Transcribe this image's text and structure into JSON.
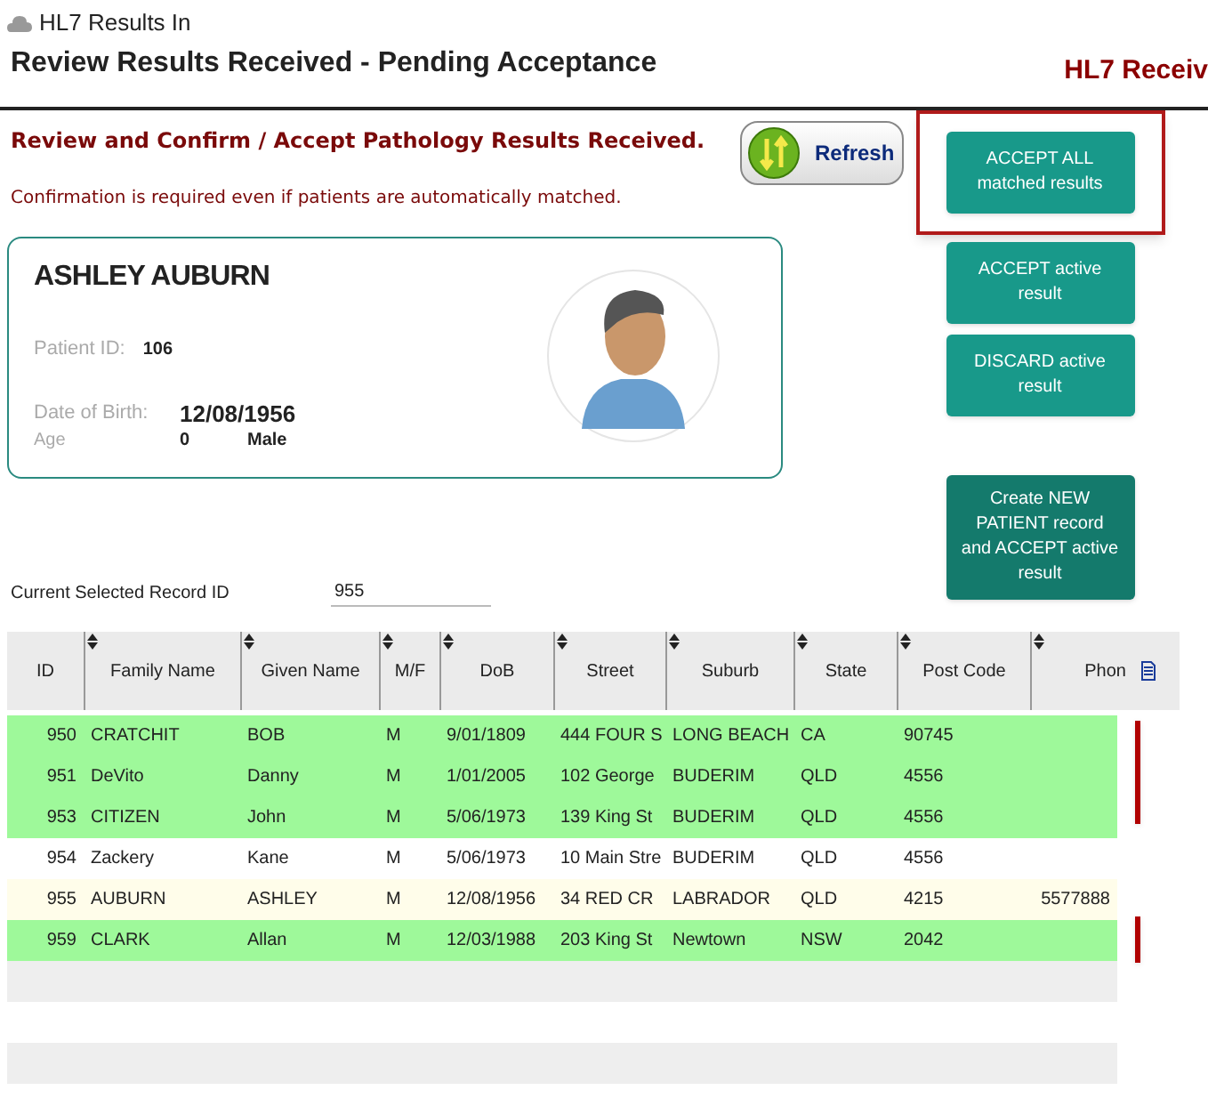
{
  "window": {
    "title": "HL7 Results In"
  },
  "header": {
    "title": "Review Results Received - Pending Acceptance",
    "right_title": "HL7 Receiv"
  },
  "intro": {
    "heading": "Review and Confirm / Accept Pathology Results Received.",
    "note": "Confirmation is required even if patients are automatically matched."
  },
  "refresh_button": "Refresh",
  "actions": [
    {
      "label": "ACCEPT ALL matched results",
      "kind": "standard",
      "highlighted": true
    },
    {
      "label": "ACCEPT active result",
      "kind": "standard",
      "highlighted": false
    },
    {
      "label": "DISCARD active result",
      "kind": "standard",
      "highlighted": false
    },
    {
      "label": "Create NEW PATIENT record and ACCEPT active result",
      "kind": "create",
      "highlighted": false
    }
  ],
  "patient": {
    "name": "ASHLEY AUBURN",
    "id_label": "Patient ID:",
    "id": "106",
    "dob_label": "Date of Birth:",
    "dob": "12/08/1956",
    "age_label": "Age",
    "age": "0",
    "sex": "Male"
  },
  "record": {
    "label": "Current Selected Record ID",
    "value": "955"
  },
  "table": {
    "columns": [
      "ID",
      "Family Name",
      "Given Name",
      "M/F",
      "DoB",
      "Street",
      "Suburb",
      "State",
      "Post Code",
      "Phon"
    ],
    "rows": [
      {
        "cells": [
          "950",
          "CRATCHIT",
          "BOB",
          "M",
          "9/01/1809",
          "444 FOUR S",
          "LONG BEACH",
          "CA",
          "90745",
          ""
        ],
        "matched": true,
        "selected": false
      },
      {
        "cells": [
          "951",
          "DeVito",
          "Danny",
          "M",
          "1/01/2005",
          "102 George",
          "BUDERIM",
          "QLD",
          "4556",
          ""
        ],
        "matched": true,
        "selected": false
      },
      {
        "cells": [
          "953",
          "CITIZEN",
          "John",
          "M",
          "5/06/1973",
          "139 King St",
          "BUDERIM",
          "QLD",
          "4556",
          ""
        ],
        "matched": true,
        "selected": false
      },
      {
        "cells": [
          "954",
          "Zackery",
          "Kane",
          "M",
          "5/06/1973",
          "10 Main Stre",
          "BUDERIM",
          "QLD",
          "4556",
          ""
        ],
        "matched": false,
        "selected": false
      },
      {
        "cells": [
          "955",
          "AUBURN",
          "ASHLEY",
          "M",
          "12/08/1956",
          "34 RED CR",
          "LABRADOR",
          "QLD",
          "4215",
          "5577888"
        ],
        "matched": false,
        "selected": true
      },
      {
        "cells": [
          "959",
          "CLARK",
          "Allan",
          "M",
          "12/03/1988",
          "203 King St",
          "Newtown",
          "NSW",
          "2042",
          ""
        ],
        "matched": true,
        "selected": false
      }
    ]
  }
}
